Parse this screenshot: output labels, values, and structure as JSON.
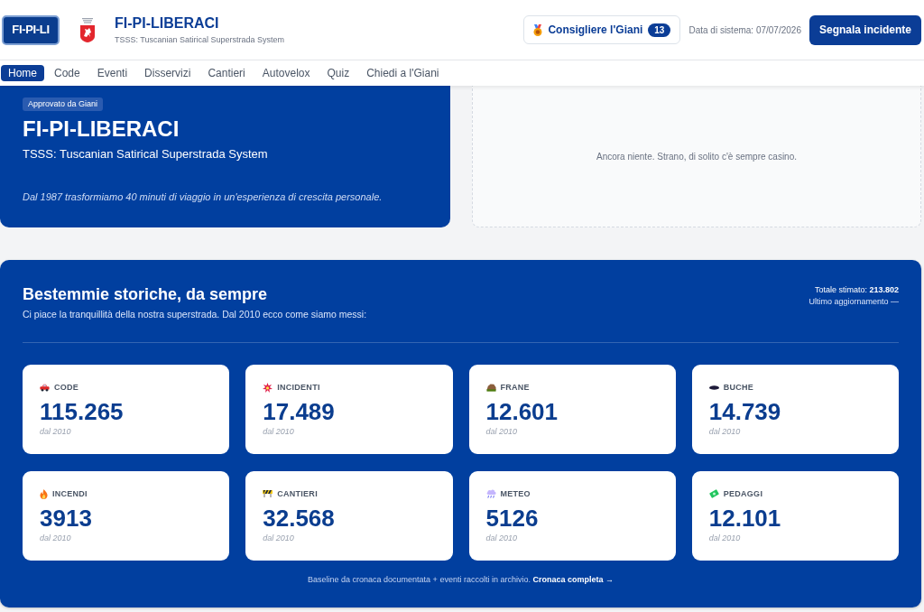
{
  "header": {
    "logo": "FI-PI-LI",
    "title": "FI-PI-LIBERACI",
    "subtitle": "TSSS: Tuscanian Satirical Superstrada System",
    "councillor_button": {
      "label": "Consigliere l'Giani",
      "count": "13"
    },
    "system_date": "Data di sistema: 07/07/2026",
    "report_button": "Segnala incidente"
  },
  "nav": {
    "tabs": [
      {
        "label": "Home",
        "selected": true
      },
      {
        "label": "Code",
        "selected": false
      },
      {
        "label": "Eventi",
        "selected": false
      },
      {
        "label": "Disservizi",
        "selected": false
      },
      {
        "label": "Cantieri",
        "selected": false
      },
      {
        "label": "Autovelox",
        "selected": false
      },
      {
        "label": "Quiz",
        "selected": false
      },
      {
        "label": "Chiedi a l'Giani",
        "selected": false
      }
    ]
  },
  "hero": {
    "badge": "Approvato da Giani",
    "title": "FI-PI-LIBERACI",
    "subtitle": "TSSS: Tuscanian Satirical Superstrada System",
    "tagline": "Dal 1987 trasformiamo 40 minuti di viaggio in un'esperienza di crescita personale."
  },
  "side_panel": {
    "empty_message": "Ancora niente. Strano, di solito c'è sempre casino."
  },
  "stats": {
    "title": "Bestemmie storiche, da sempre",
    "subtitle": "Ci piace la tranquillità della nostra superstrada. Dal 2010 ecco come siamo messi:",
    "total": "Totale stimato: **213.802**",
    "last_update": "Ultimo aggiornamento —",
    "cards": [
      {
        "label": "CODE",
        "value": "115.265",
        "note": "dal 2010"
      },
      {
        "label": "INCIDENTI",
        "value": "17.489",
        "note": "dal 2010"
      },
      {
        "label": "FRANE",
        "value": "12.601",
        "note": "dal 2010"
      },
      {
        "label": "BUCHE",
        "value": "14.739",
        "note": "dal 2010"
      },
      {
        "label": "INCENDI",
        "value": "3913",
        "note": "dal 2010"
      },
      {
        "label": "CANTIERI",
        "value": "32.568",
        "note": "dal 2010"
      },
      {
        "label": "METEO",
        "value": "5126",
        "note": "dal 2010"
      },
      {
        "label": "PEDAGGI",
        "value": "12.101",
        "note": "dal 2010"
      }
    ],
    "footnote": "Baseline da cronaca documentata + eventi raccolti in archivio.",
    "footnote_link": "Cronaca completa →"
  }
}
